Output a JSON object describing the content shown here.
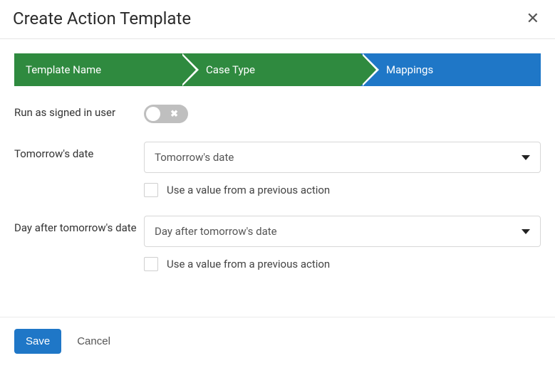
{
  "header": {
    "title": "Create Action Template"
  },
  "steps": [
    {
      "label": "Template Name",
      "status": "done"
    },
    {
      "label": "Case Type",
      "status": "done"
    },
    {
      "label": "Mappings",
      "status": "current"
    }
  ],
  "form": {
    "run_as_label": "Run as signed in user",
    "run_as_value": false,
    "fields": [
      {
        "label": "Tomorrow's date",
        "select_value": "Tomorrow's date",
        "use_prev_label": "Use a value from a previous action",
        "use_prev_checked": false
      },
      {
        "label": "Day after tomorrow's date",
        "select_value": "Day after tomorrow's date",
        "use_prev_label": "Use a value from a previous action",
        "use_prev_checked": false
      }
    ]
  },
  "footer": {
    "save_label": "Save",
    "cancel_label": "Cancel"
  }
}
